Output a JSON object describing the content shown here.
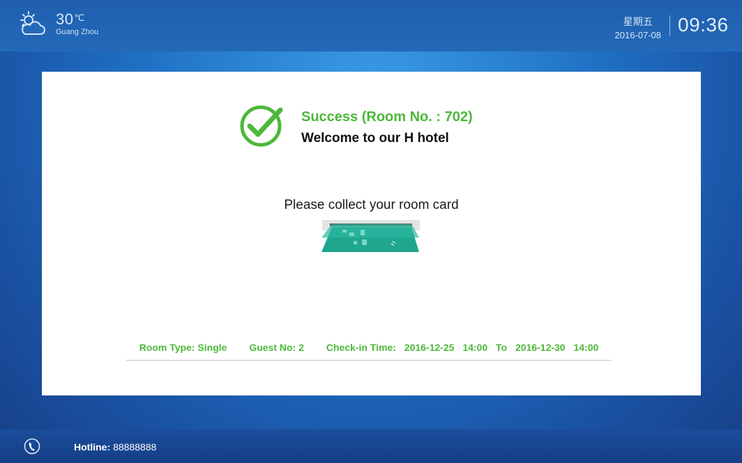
{
  "header": {
    "weather_icon": "partly-cloudy-icon",
    "temperature": "30",
    "temperature_unit": "℃",
    "city": "Guang Zhou",
    "weekday": "星期五",
    "date": "2016-07-08",
    "time": "09:36"
  },
  "result": {
    "status_icon": "check-circle-icon",
    "success_text": "Success (Room No. : 702)",
    "welcome_text": "Welcome to our H hotel",
    "collect_text": "Please collect your room card",
    "card_icon": "room-card-slot-icon"
  },
  "booking": {
    "room_type": "Room Type: Single",
    "guest_no": "Guest No: 2",
    "checkin_label": "Check-in Time:",
    "start_date": "2016-12-25",
    "start_time": "14:00",
    "to_label": "To",
    "end_date": "2016-12-30",
    "end_time": "14:00"
  },
  "footer": {
    "phone_icon": "phone-icon",
    "hotline_label": "Hotline:",
    "hotline_number": "88888888"
  },
  "colors": {
    "accent_green": "#4cb83a",
    "header_blue": "#2369b8",
    "background_blue": "#1f6fc3"
  }
}
